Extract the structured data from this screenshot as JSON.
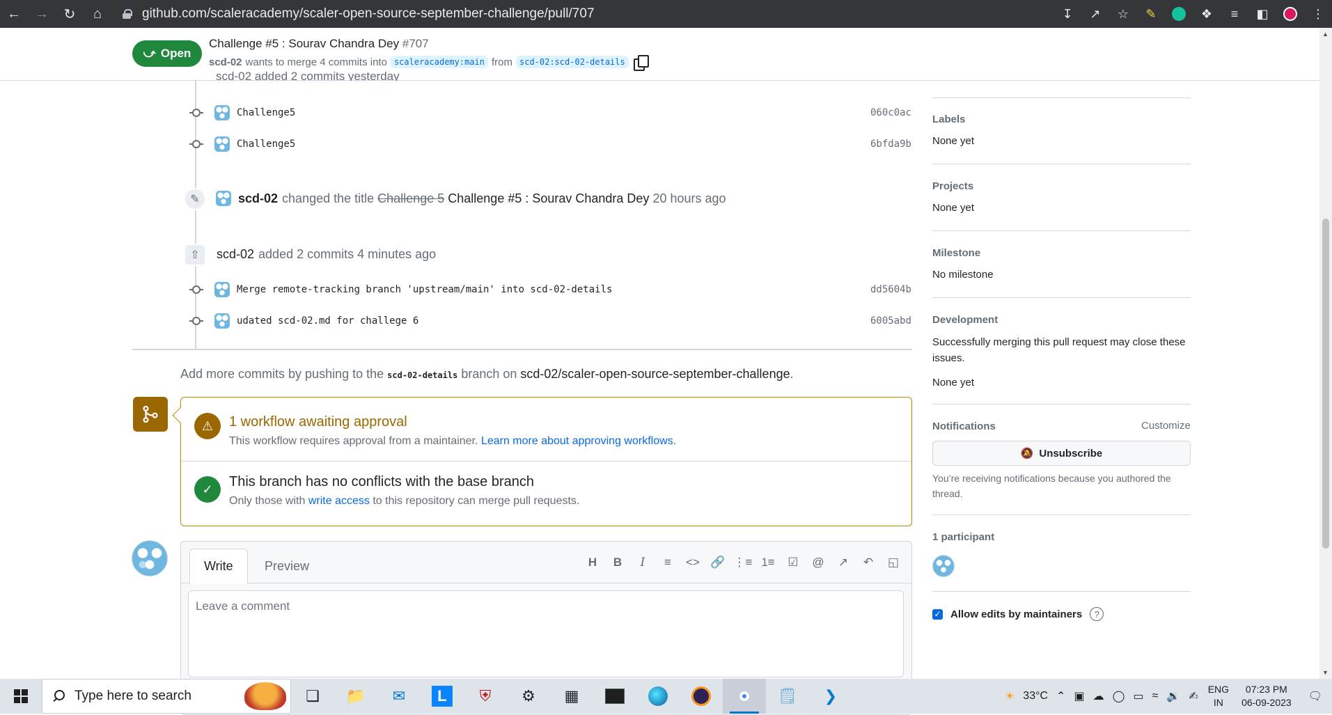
{
  "browser": {
    "url": "github.com/scaleracademy/scaler-open-source-september-challenge/pull/707"
  },
  "pr": {
    "state": "Open",
    "title": "Challenge #5 : Sourav Chandra Dey",
    "number": "#707",
    "author": "scd-02",
    "merge_text": "wants to merge 4 commits into",
    "base_branch": "scaleracademy:main",
    "from_text": "from",
    "head_branch": "scd-02:scd-02-details"
  },
  "timeline": {
    "partial_event": "scd-02 added 2 commits yesterday",
    "first_commits": [
      {
        "message": "Challenge5",
        "sha": "060c0ac"
      },
      {
        "message": "Challenge5",
        "sha": "6bfda9b"
      }
    ],
    "title_change": {
      "actor": "scd-02",
      "action": "changed the title",
      "old_title": "Challenge 5",
      "new_title": "Challenge #5 : Sourav Chandra Dey",
      "time": "20 hours ago"
    },
    "commits_event": {
      "actor": "scd-02",
      "action": "added 2 commits",
      "time": "4 minutes ago"
    },
    "second_commits": [
      {
        "message": "Merge remote-tracking branch 'upstream/main' into scd-02-details",
        "sha": "dd5604b"
      },
      {
        "message": "udated scd-02.md for challege 6",
        "sha": "6005abd"
      }
    ],
    "push_hint": {
      "prefix": "Add more commits by pushing to the",
      "branch": "scd-02-details",
      "middle": "branch on",
      "repo": "scd-02/scaler-open-source-september-challenge",
      "suffix": "."
    }
  },
  "merge_box": {
    "workflow_title": "1 workflow awaiting approval",
    "workflow_desc": "This workflow requires approval from a maintainer.",
    "workflow_link": "Learn more about approving workflows.",
    "conflict_title": "This branch has no conflicts with the base branch",
    "conflict_desc_prefix": "Only those with",
    "conflict_link": "write access",
    "conflict_desc_suffix": "to this repository can merge pull requests."
  },
  "editor": {
    "tab_write": "Write",
    "tab_preview": "Preview",
    "placeholder": "Leave a comment"
  },
  "sidebar": {
    "labels_heading": "Labels",
    "labels_value": "None yet",
    "projects_heading": "Projects",
    "projects_value": "None yet",
    "milestone_heading": "Milestone",
    "milestone_value": "No milestone",
    "development_heading": "Development",
    "development_text": "Successfully merging this pull request may close these issues.",
    "development_value": "None yet",
    "notifications_heading": "Notifications",
    "customize": "Customize",
    "unsubscribe": "Unsubscribe",
    "notifications_note": "You’re receiving notifications because you authored the thread.",
    "participants_heading": "1 participant",
    "allow_edits": "Allow edits by maintainers"
  },
  "taskbar": {
    "search_placeholder": "Type here to search",
    "weather": "33°C",
    "lang_top": "ENG",
    "lang_bottom": "IN",
    "time": "07:23 PM",
    "date": "06-09-2023"
  },
  "colors": {
    "open_green": "#1f883d",
    "attention": "#9a6700",
    "accent_blue": "#0969da"
  }
}
